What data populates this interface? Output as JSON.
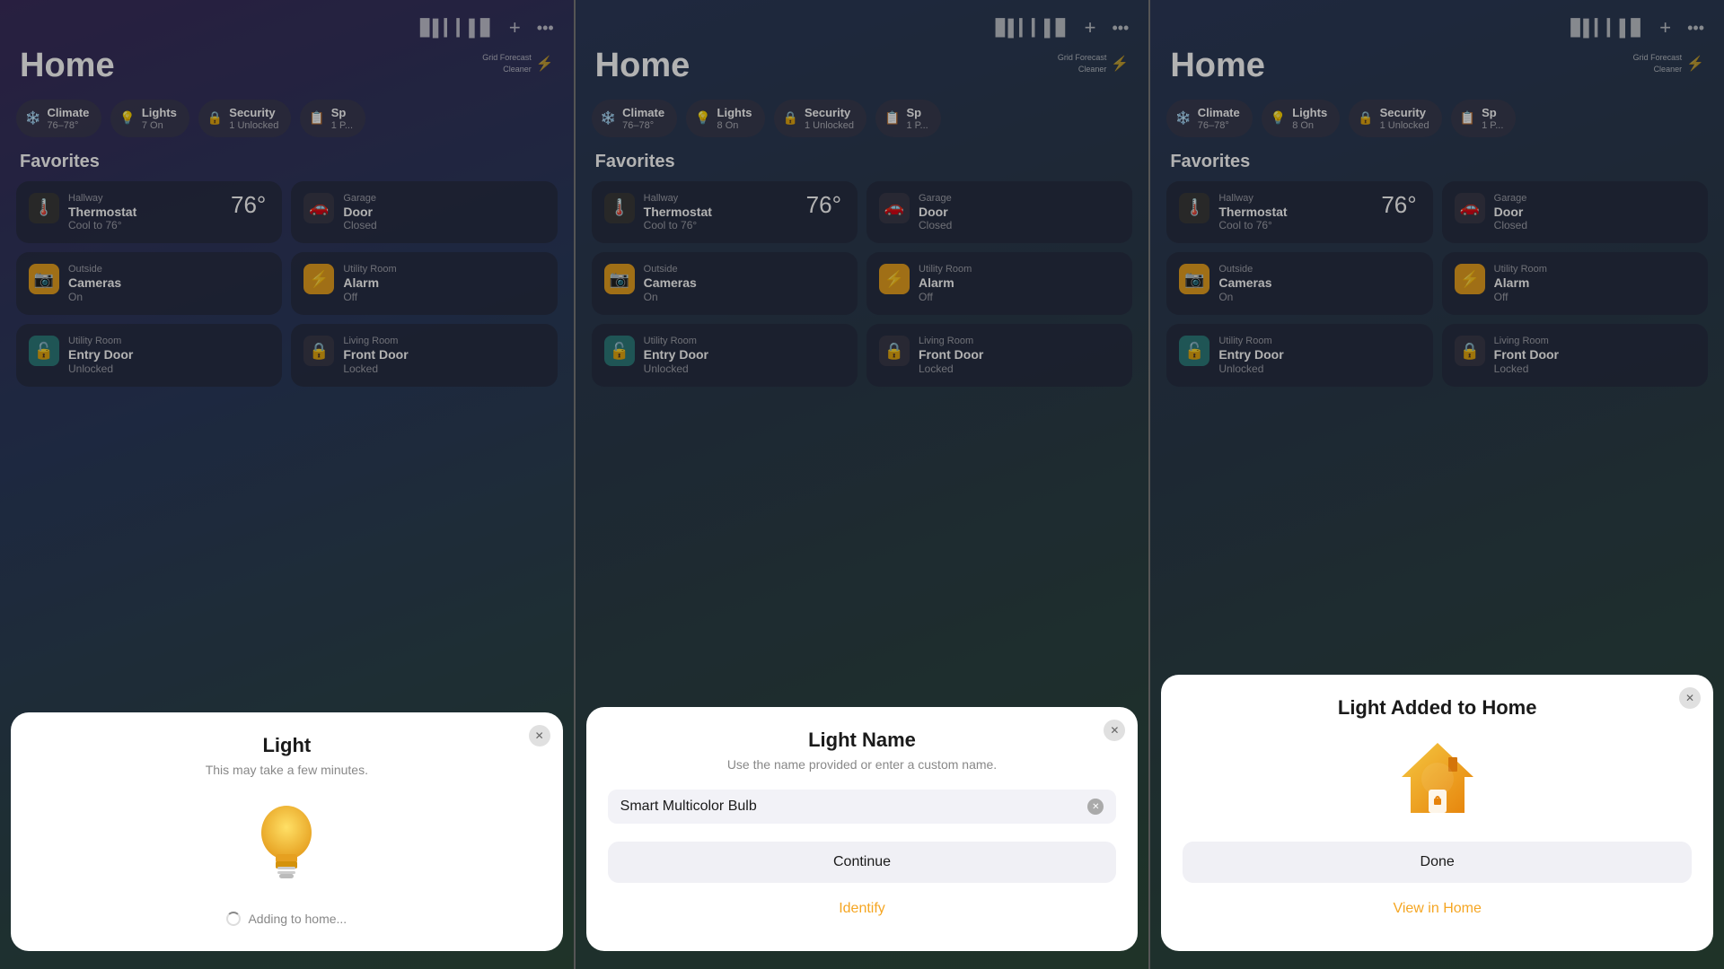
{
  "panels": [
    {
      "id": "panel-1",
      "title": "Home",
      "gridForecast": "Grid Forecast\nCleaner",
      "categories": [
        {
          "id": "climate",
          "icon": "❄️",
          "label": "Climate",
          "sub": "76–78°"
        },
        {
          "id": "lights",
          "icon": "💡",
          "label": "Lights",
          "sub": "7 On"
        },
        {
          "id": "security",
          "icon": "🔒",
          "label": "Security",
          "sub": "1 Unlocked"
        },
        {
          "id": "sp",
          "icon": "📋",
          "label": "Sp",
          "sub": "1 P..."
        }
      ],
      "favoritesLabel": "Favorites",
      "tiles": [
        {
          "id": "thermostat",
          "room": "Hallway",
          "name": "Thermostat",
          "status": "Cool to 76°",
          "icon": "🌡️",
          "iconClass": "tile-icon-thermostat",
          "temp": "76°"
        },
        {
          "id": "garage",
          "room": "Garage",
          "name": "Door",
          "status": "Closed",
          "icon": "🚗",
          "iconClass": "tile-icon-door"
        },
        {
          "id": "cameras",
          "room": "Outside",
          "name": "Cameras",
          "status": "On",
          "icon": "📷",
          "iconClass": "tile-icon-camera"
        },
        {
          "id": "alarm",
          "room": "Utility Room",
          "name": "Alarm",
          "status": "Off",
          "icon": "⚡",
          "iconClass": "tile-icon-alarm"
        },
        {
          "id": "entrydoor",
          "room": "Utility Room",
          "name": "Entry Door",
          "status": "Unlocked",
          "icon": "🔓",
          "iconClass": "tile-icon-lock-open"
        },
        {
          "id": "frontdoor",
          "room": "Living Room",
          "name": "Front Door",
          "status": "Locked",
          "icon": "🔒",
          "iconClass": "tile-icon-lock-closed"
        }
      ],
      "modal": {
        "type": "adding",
        "title": "Light",
        "subtitle": "This may take a few minutes.",
        "closable": true,
        "addingText": "Adding to home..."
      }
    },
    {
      "id": "panel-2",
      "title": "Home",
      "gridForecast": "Grid Forecast\nCleaner",
      "categories": [
        {
          "id": "climate",
          "icon": "❄️",
          "label": "Climate",
          "sub": "76–78°"
        },
        {
          "id": "lights",
          "icon": "💡",
          "label": "Lights",
          "sub": "8 On"
        },
        {
          "id": "security",
          "icon": "🔒",
          "label": "Security",
          "sub": "1 Unlocked"
        },
        {
          "id": "sp",
          "icon": "📋",
          "label": "Sp",
          "sub": "1 P..."
        }
      ],
      "favoritesLabel": "Favorites",
      "tiles": [
        {
          "id": "thermostat",
          "room": "Hallway",
          "name": "Thermostat",
          "status": "Cool to 76°",
          "icon": "🌡️",
          "iconClass": "tile-icon-thermostat",
          "temp": "76°"
        },
        {
          "id": "garage",
          "room": "Garage",
          "name": "Door",
          "status": "Closed",
          "icon": "🚗",
          "iconClass": "tile-icon-door"
        },
        {
          "id": "cameras",
          "room": "Outside",
          "name": "Cameras",
          "status": "On",
          "icon": "📷",
          "iconClass": "tile-icon-camera"
        },
        {
          "id": "alarm",
          "room": "Utility Room",
          "name": "Alarm",
          "status": "Off",
          "icon": "⚡",
          "iconClass": "tile-icon-alarm"
        },
        {
          "id": "entrydoor",
          "room": "Utility Room",
          "name": "Entry Door",
          "status": "Unlocked",
          "icon": "🔓",
          "iconClass": "tile-icon-lock-open"
        },
        {
          "id": "frontdoor",
          "room": "Living Room",
          "name": "Front Door",
          "status": "Locked",
          "icon": "🔒",
          "iconClass": "tile-icon-lock-closed"
        }
      ],
      "modal": {
        "type": "name",
        "title": "Light Name",
        "subtitle": "Use the name provided or enter a custom name.",
        "closable": true,
        "inputValue": "Smart Multicolor Bulb",
        "continueLabel": "Continue",
        "identifyLabel": "Identify"
      }
    },
    {
      "id": "panel-3",
      "title": "Home",
      "gridForecast": "Grid Forecast\nCleaner",
      "categories": [
        {
          "id": "climate",
          "icon": "❄️",
          "label": "Climate",
          "sub": "76–78°"
        },
        {
          "id": "lights",
          "icon": "💡",
          "label": "Lights",
          "sub": "8 On"
        },
        {
          "id": "security",
          "icon": "🔒",
          "label": "Security",
          "sub": "1 Unlocked"
        },
        {
          "id": "sp",
          "icon": "📋",
          "label": "Sp",
          "sub": "1 P..."
        }
      ],
      "favoritesLabel": "Favorites",
      "tiles": [
        {
          "id": "thermostat",
          "room": "Hallway",
          "name": "Thermostat",
          "status": "Cool to 76°",
          "icon": "🌡️",
          "iconClass": "tile-icon-thermostat",
          "temp": "76°"
        },
        {
          "id": "garage",
          "room": "Garage",
          "name": "Door",
          "status": "Closed",
          "icon": "🚗",
          "iconClass": "tile-icon-door"
        },
        {
          "id": "cameras",
          "room": "Outside",
          "name": "Cameras",
          "status": "On",
          "icon": "📷",
          "iconClass": "tile-icon-camera"
        },
        {
          "id": "alarm",
          "room": "Utility Room",
          "name": "Alarm",
          "status": "Off",
          "icon": "⚡",
          "iconClass": "tile-icon-alarm"
        },
        {
          "id": "entrydoor",
          "room": "Utility Room",
          "name": "Entry Door",
          "status": "Unlocked",
          "icon": "🔓",
          "iconClass": "tile-icon-lock-open"
        },
        {
          "id": "frontdoor",
          "room": "Living Room",
          "name": "Front Door",
          "status": "Locked",
          "icon": "🔒",
          "iconClass": "tile-icon-lock-closed"
        }
      ],
      "modal": {
        "type": "added",
        "title": "Light Added to Home",
        "closable": true,
        "doneLabel": "Done",
        "viewHomeLabel": "View in Home"
      }
    }
  ]
}
